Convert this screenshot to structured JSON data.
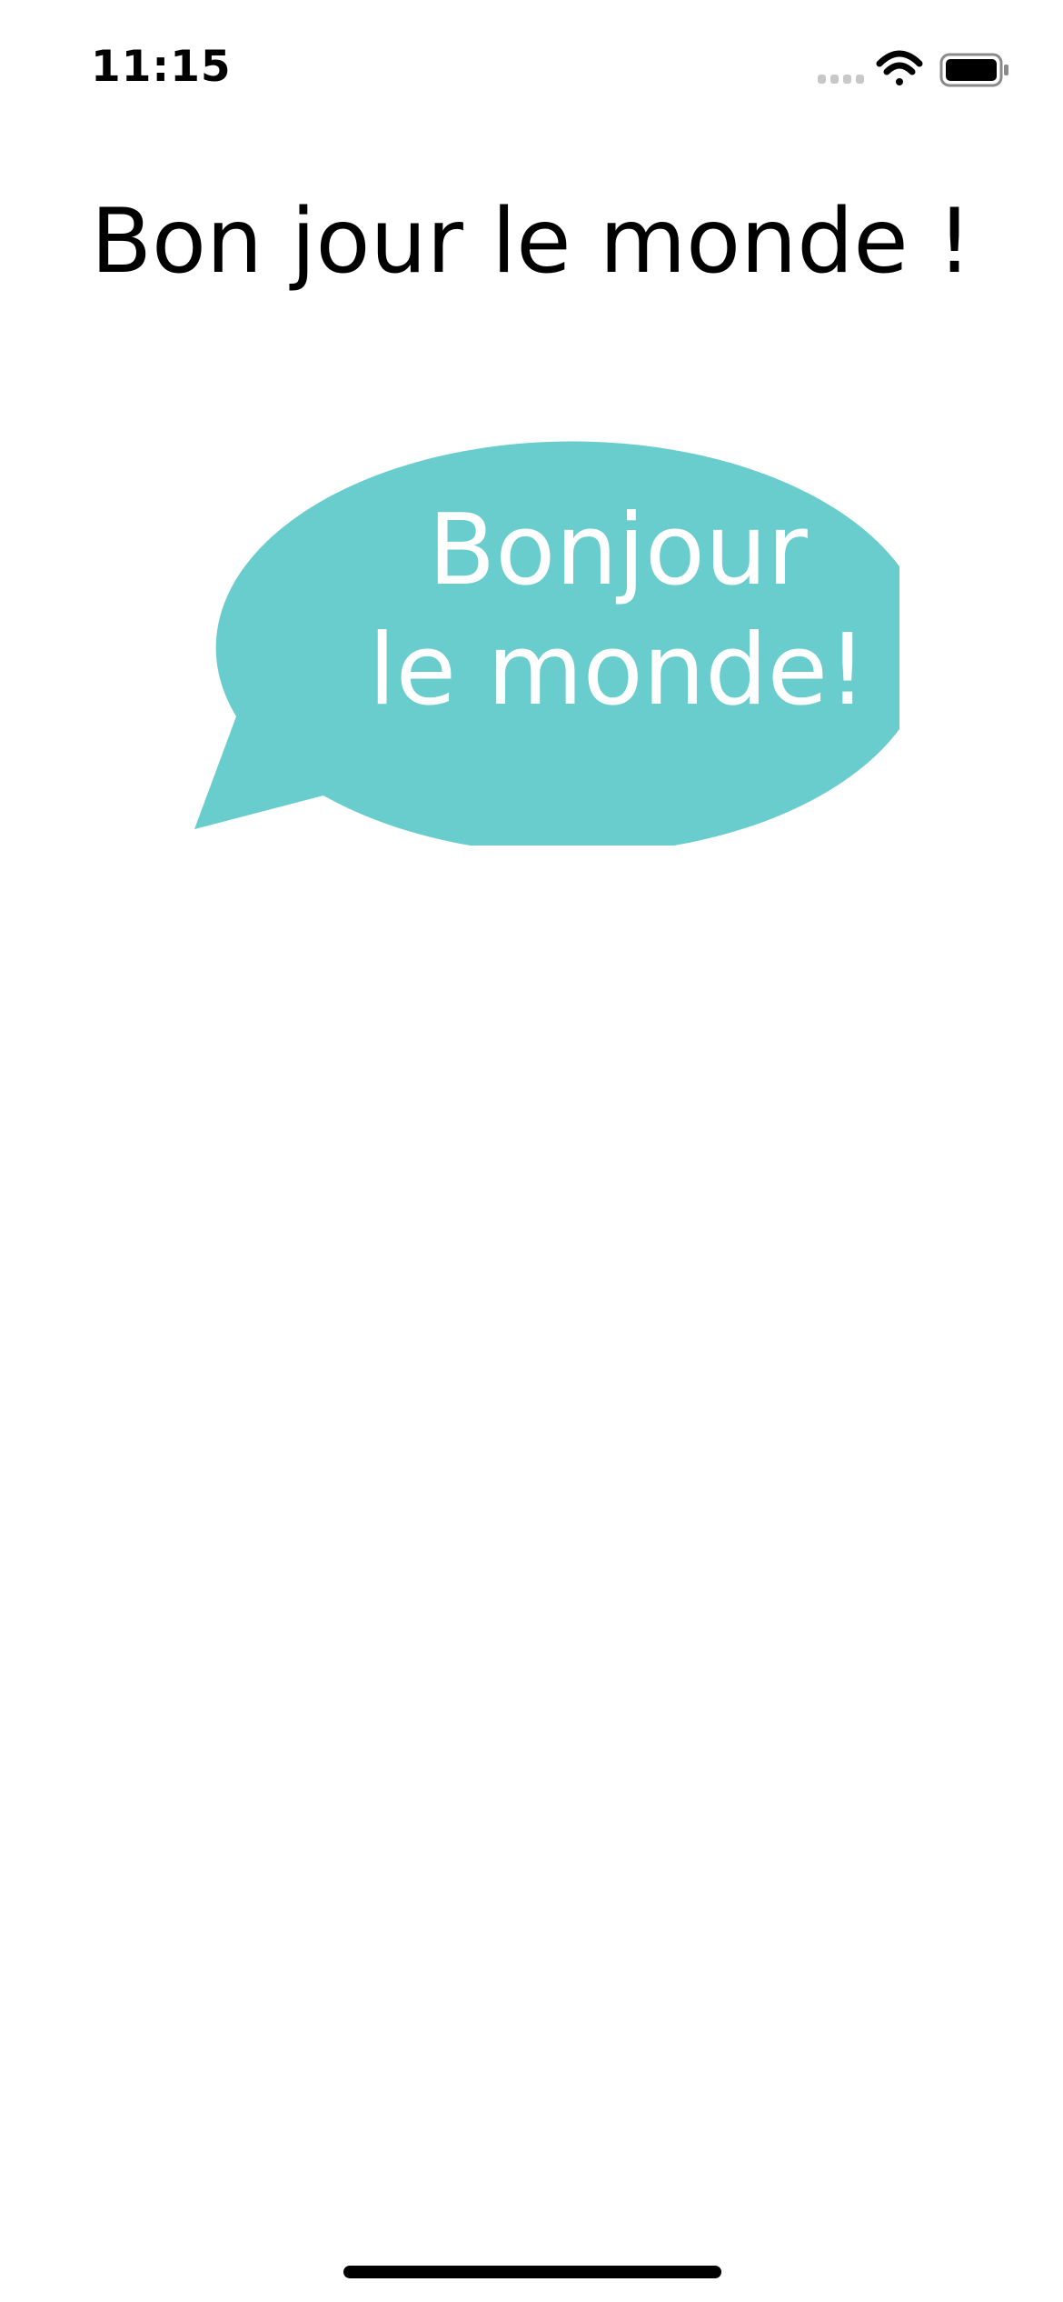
{
  "status_bar": {
    "time": "11:15",
    "icons": [
      "cellular-signal-icon",
      "wifi-icon",
      "battery-icon"
    ]
  },
  "headline": "Bon jour le monde !",
  "speech_bubble": {
    "color": "#69CDCD",
    "lines": [
      "Bonjour",
      "le monde!"
    ]
  }
}
